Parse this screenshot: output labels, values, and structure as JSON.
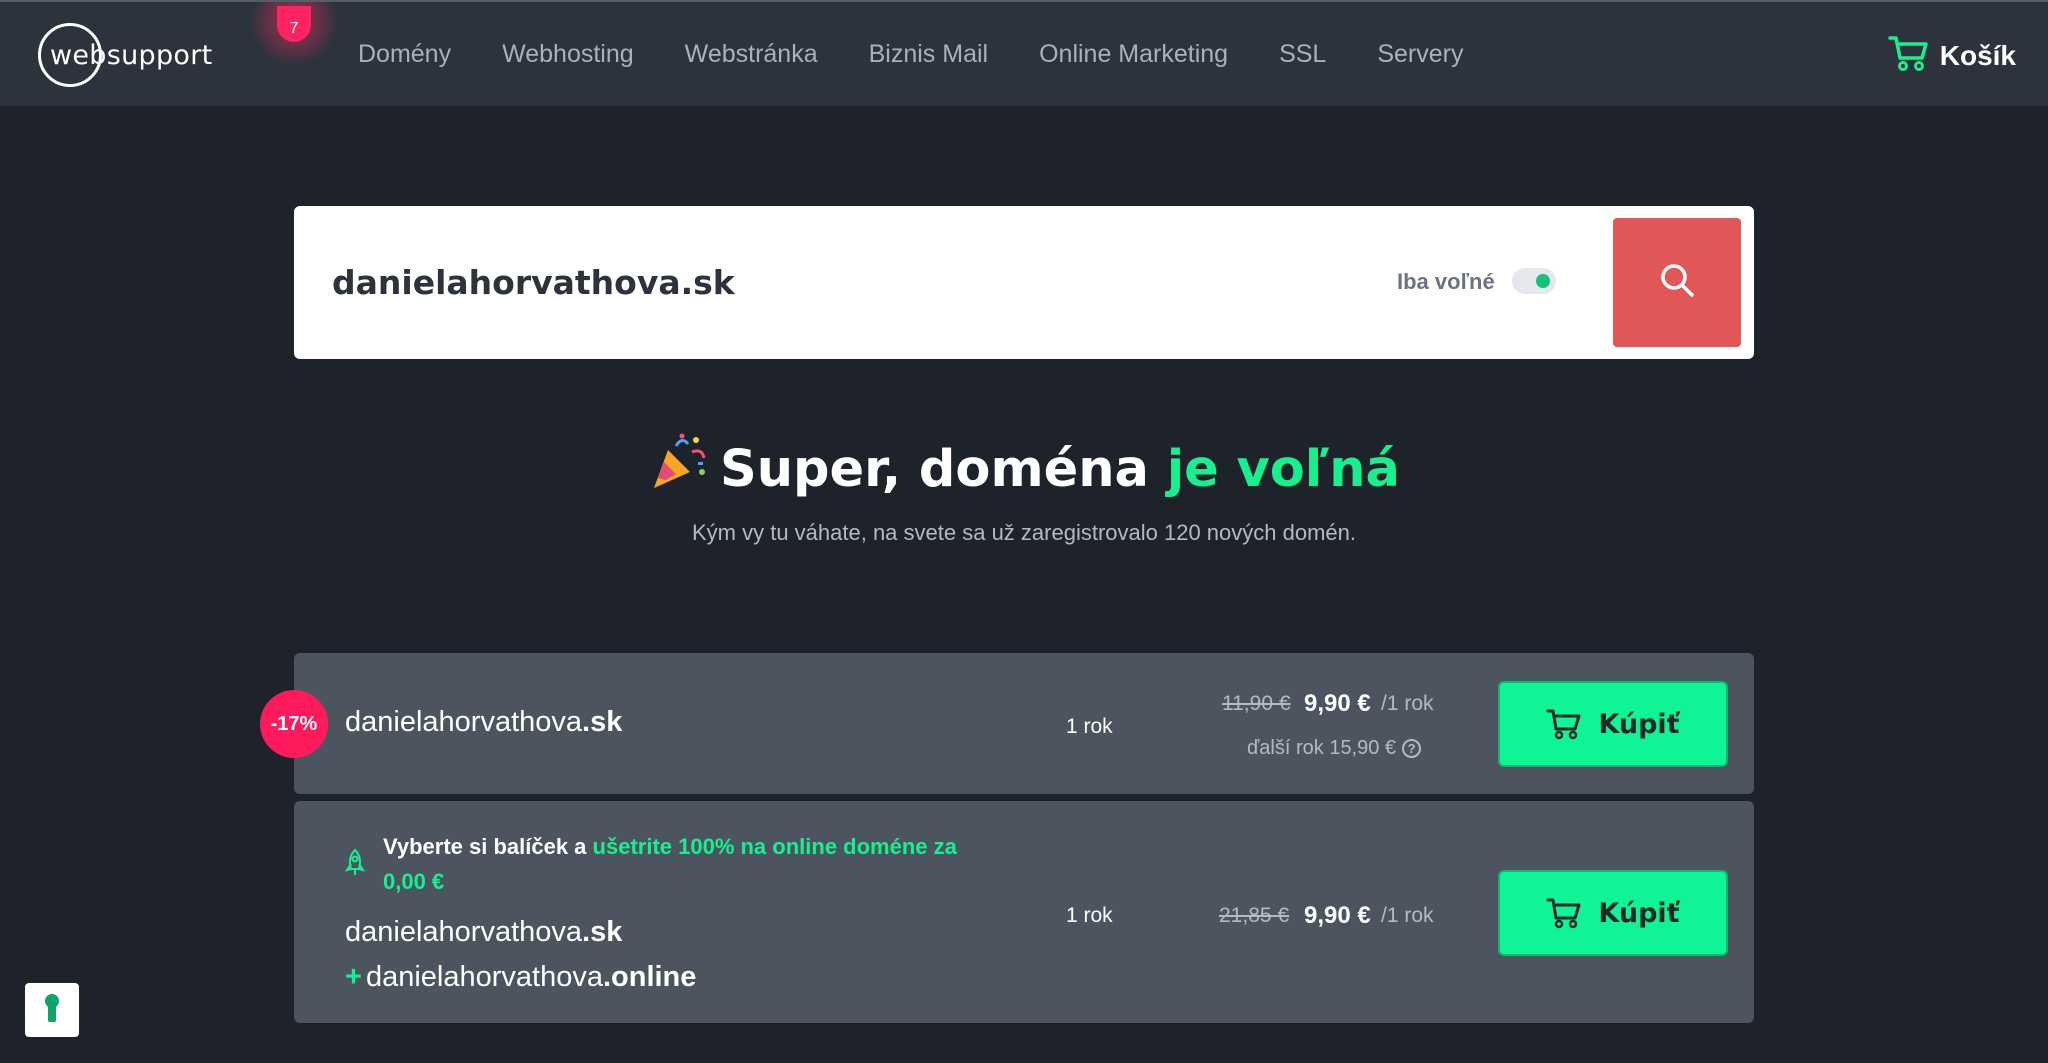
{
  "header": {
    "logo_text": "websupport",
    "notification_count": "7",
    "nav": [
      "Domény",
      "Webhosting",
      "Webstránka",
      "Biznis Mail",
      "Online Marketing",
      "SSL",
      "Servery"
    ],
    "cart_label": "Košík"
  },
  "search": {
    "value": "danielahorvathova.sk",
    "filter_label": "Iba voľné",
    "filter_on": true
  },
  "headline": {
    "part1": "Super, doména ",
    "accent": "je voľná",
    "subline": "Kým vy tu váhate, na svete sa už zaregistrovalo 120 nových domén."
  },
  "results": [
    {
      "discount": "-17%",
      "domain_name": "danielahorvathova",
      "domain_tld": ".sk",
      "period": "1 rok",
      "old_price": "11,90 €",
      "price": "9,90 €",
      "per": "/1 rok",
      "next_year": "ďalší rok 15,90 €",
      "button": "Kúpiť"
    },
    {
      "promo_text": "Vyberte si balíček a ",
      "promo_accent": "ušetrite 100% na online doméne za 0,00 €",
      "domain_name": "danielahorvathova",
      "domain_tld": ".sk",
      "addon_prefix": "+",
      "addon_name": "danielahorvathova",
      "addon_tld": ".online",
      "period": "1 rok",
      "old_price": "21,85 €",
      "price": "9,90 €",
      "per": "/1 rok",
      "button": "Kúpiť"
    }
  ],
  "colors": {
    "background": "#1e232b",
    "header": "#2c333d",
    "accent_green": "#17f08f",
    "search_button": "#e15656",
    "discount_badge": "#ff1a5c",
    "card": "#4c555f"
  }
}
